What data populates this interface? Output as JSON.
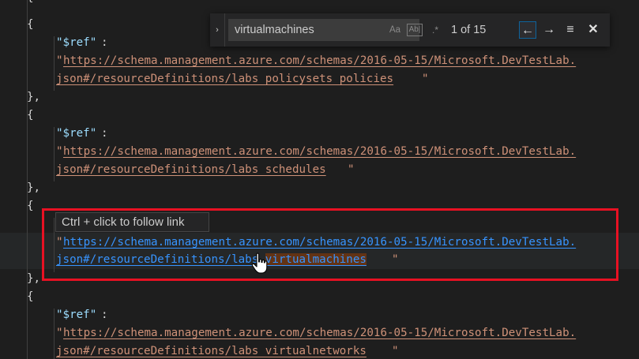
{
  "find": {
    "query": "virtualmachines",
    "match_case_label": "Aa",
    "whole_word_label": "Ab|",
    "regex_label": ".*",
    "match_count": "1 of 15",
    "toggle_glyph": "›",
    "prev_glyph": "←",
    "next_glyph": "→",
    "selection_glyph": "≡",
    "close_glyph": "✕"
  },
  "tooltip": {
    "text": "Ctrl + click to follow link"
  },
  "code": {
    "open_brace": "{",
    "close_brace_comma": "},",
    "ref_key": "\"$ref\"",
    "colon": ":",
    "quote": "\"",
    "blocks": [
      {
        "url_line1": "https://schema.management.azure.com/schemas/2016-05-15/Microsoft.DevTestLab.",
        "url_line2": "json#/resourceDefinitions/labs_policysets_policies"
      },
      {
        "url_line1": "https://schema.management.azure.com/schemas/2016-05-15/Microsoft.DevTestLab.",
        "url_line2": "json#/resourceDefinitions/labs_schedules"
      },
      {
        "url_line1": "https://schema.management.azure.com/schemas/2016-05-15/Microsoft.DevTestLab.",
        "url_line2_prefix": "json#/resourceDefinitions/labs_",
        "url_line2_match": "virtualmachines"
      },
      {
        "url_line1": "https://schema.management.azure.com/schemas/2016-05-15/Microsoft.DevTestLab.",
        "url_line2": "json#/resourceDefinitions/labs_virtualnetworks"
      }
    ]
  },
  "colors": {
    "editor_background": "#1e1e1e",
    "string": "#ce9178",
    "key": "#9cdcfe",
    "link_hover": "#3794ff",
    "highlight_box": "#e81123"
  }
}
